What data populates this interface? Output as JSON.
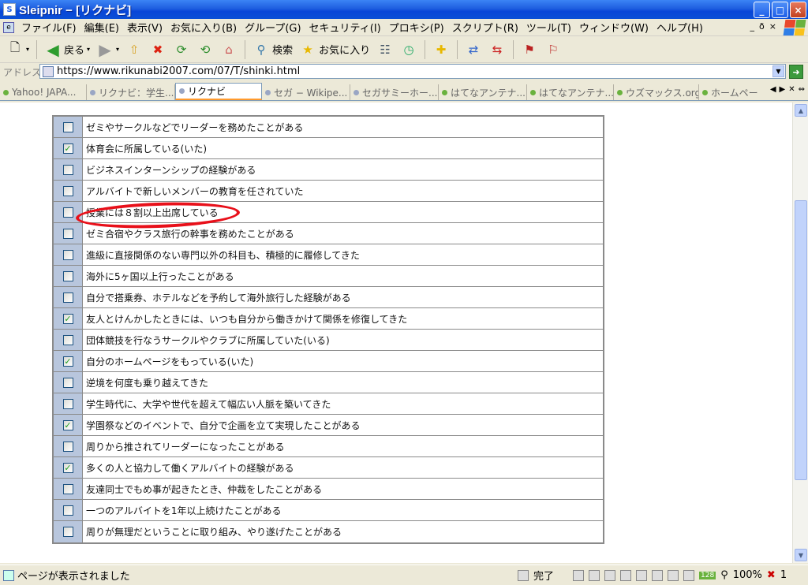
{
  "window": {
    "title": "Sleipnir − [リクナビ]",
    "min_label": "_",
    "max_label": "□",
    "close_label": "×"
  },
  "menu": [
    "ファイル(F)",
    "編集(E)",
    "表示(V)",
    "お気に入り(B)",
    "グループ(G)",
    "セキュリティ(I)",
    "プロキシ(P)",
    "スクリプト(R)",
    "ツール(T)",
    "ウィンドウ(W)",
    "ヘルプ(H)"
  ],
  "mdi_controls": [
    "_",
    "ð",
    "×"
  ],
  "toolbar": {
    "back_label": "戻る",
    "search_label": "検索",
    "favorites_label": "お気に入り"
  },
  "address": {
    "label": "アドレス",
    "url": "https://www.rikunabi2007.com/07/T/shinki.html"
  },
  "tabs": [
    {
      "label": "Yahoo! JAPA...",
      "active": false,
      "dot": "#6ab23e"
    },
    {
      "label": "リクナビ：学生...",
      "active": false,
      "dot": "#9aa6c4"
    },
    {
      "label": "リクナビ",
      "active": true,
      "dot": "#9aa6c4"
    },
    {
      "label": "セガ − Wikipe...",
      "active": false,
      "dot": "#9aa6c4"
    },
    {
      "label": "セガサミーホー...",
      "active": false,
      "dot": "#9aa6c4"
    },
    {
      "label": "はてなアンテナ...",
      "active": false,
      "dot": "#6ab23e"
    },
    {
      "label": "はてなアンテナ...",
      "active": false,
      "dot": "#6ab23e"
    },
    {
      "label": "ウズマックス.org",
      "active": false,
      "dot": "#6ab23e"
    },
    {
      "label": "ホームペー",
      "active": false,
      "dot": "#6ab23e"
    }
  ],
  "checklist": [
    {
      "label": "ゼミやサークルなどでリーダーを務めたことがある",
      "checked": false
    },
    {
      "label": "体育会に所属している(いた)",
      "checked": true
    },
    {
      "label": "ビジネスインターンシップの経験がある",
      "checked": false
    },
    {
      "label": "アルバイトで新しいメンバーの教育を任されていた",
      "checked": false
    },
    {
      "label": "授業には８割以上出席している",
      "checked": false
    },
    {
      "label": "ゼミ合宿やクラス旅行の幹事を務めたことがある",
      "checked": false
    },
    {
      "label": "進級に直接関係のない専門以外の科目も、積極的に履修してきた",
      "checked": false
    },
    {
      "label": "海外に5ヶ国以上行ったことがある",
      "checked": false
    },
    {
      "label": "自分で搭乗券、ホテルなどを予約して海外旅行した経験がある",
      "checked": false
    },
    {
      "label": "友人とけんかしたときには、いつも自分から働きかけて関係を修復してきた",
      "checked": true
    },
    {
      "label": "団体競技を行なうサークルやクラブに所属していた(いる)",
      "checked": false
    },
    {
      "label": "自分のホームページをもっている(いた)",
      "checked": true
    },
    {
      "label": "逆境を何度も乗り越えてきた",
      "checked": false
    },
    {
      "label": "学生時代に、大学や世代を超えて幅広い人脈を築いてきた",
      "checked": false
    },
    {
      "label": "学園祭などのイベントで、自分で企画を立て実現したことがある",
      "checked": true
    },
    {
      "label": "周りから推されてリーダーになったことがある",
      "checked": false
    },
    {
      "label": "多くの人と協力して働くアルバイトの経験がある",
      "checked": true
    },
    {
      "label": "友達同士でもめ事が起きたとき、仲裁をしたことがある",
      "checked": false
    },
    {
      "label": "一つのアルバイトを1年以上続けたことがある",
      "checked": false
    },
    {
      "label": "周りが無理だということに取り組み、やり遂げたことがある",
      "checked": false
    }
  ],
  "status": {
    "message": "ページが表示されました",
    "done": "完了",
    "badge": "128",
    "zoom": "100%",
    "errors": "1"
  },
  "colors": {
    "checkbox_column": "#b8c6dd",
    "highlight_circle": "#e8101a",
    "check_mark": "#21a121",
    "title_bar": "#0846d8"
  }
}
